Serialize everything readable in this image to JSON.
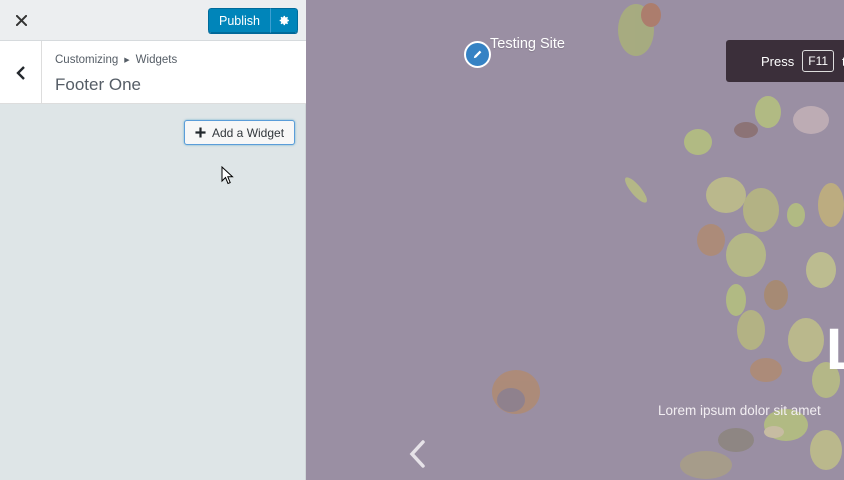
{
  "header": {
    "publish_label": "Publish"
  },
  "section": {
    "breadcrumb_parent": "Customizing",
    "breadcrumb_current": "Widgets",
    "title": "Footer One"
  },
  "add_widget_label": "Add a Widget",
  "preview": {
    "site_title": "Testing Site",
    "fullscreen_press": "Press",
    "fullscreen_key": "F11",
    "fullscreen_suffix": "to",
    "hero_letter": "L",
    "hero_text": "Lorem ipsum dolor sit amet"
  },
  "colors": {
    "accent": "#0085ba",
    "sidebar_bg": "#dee5e7",
    "preview_overlay": "#9a8fa3"
  },
  "icons": [
    "close-icon",
    "gear-icon",
    "chevron-left-icon",
    "plus-icon",
    "pencil-icon",
    "mouse-cursor-icon"
  ]
}
